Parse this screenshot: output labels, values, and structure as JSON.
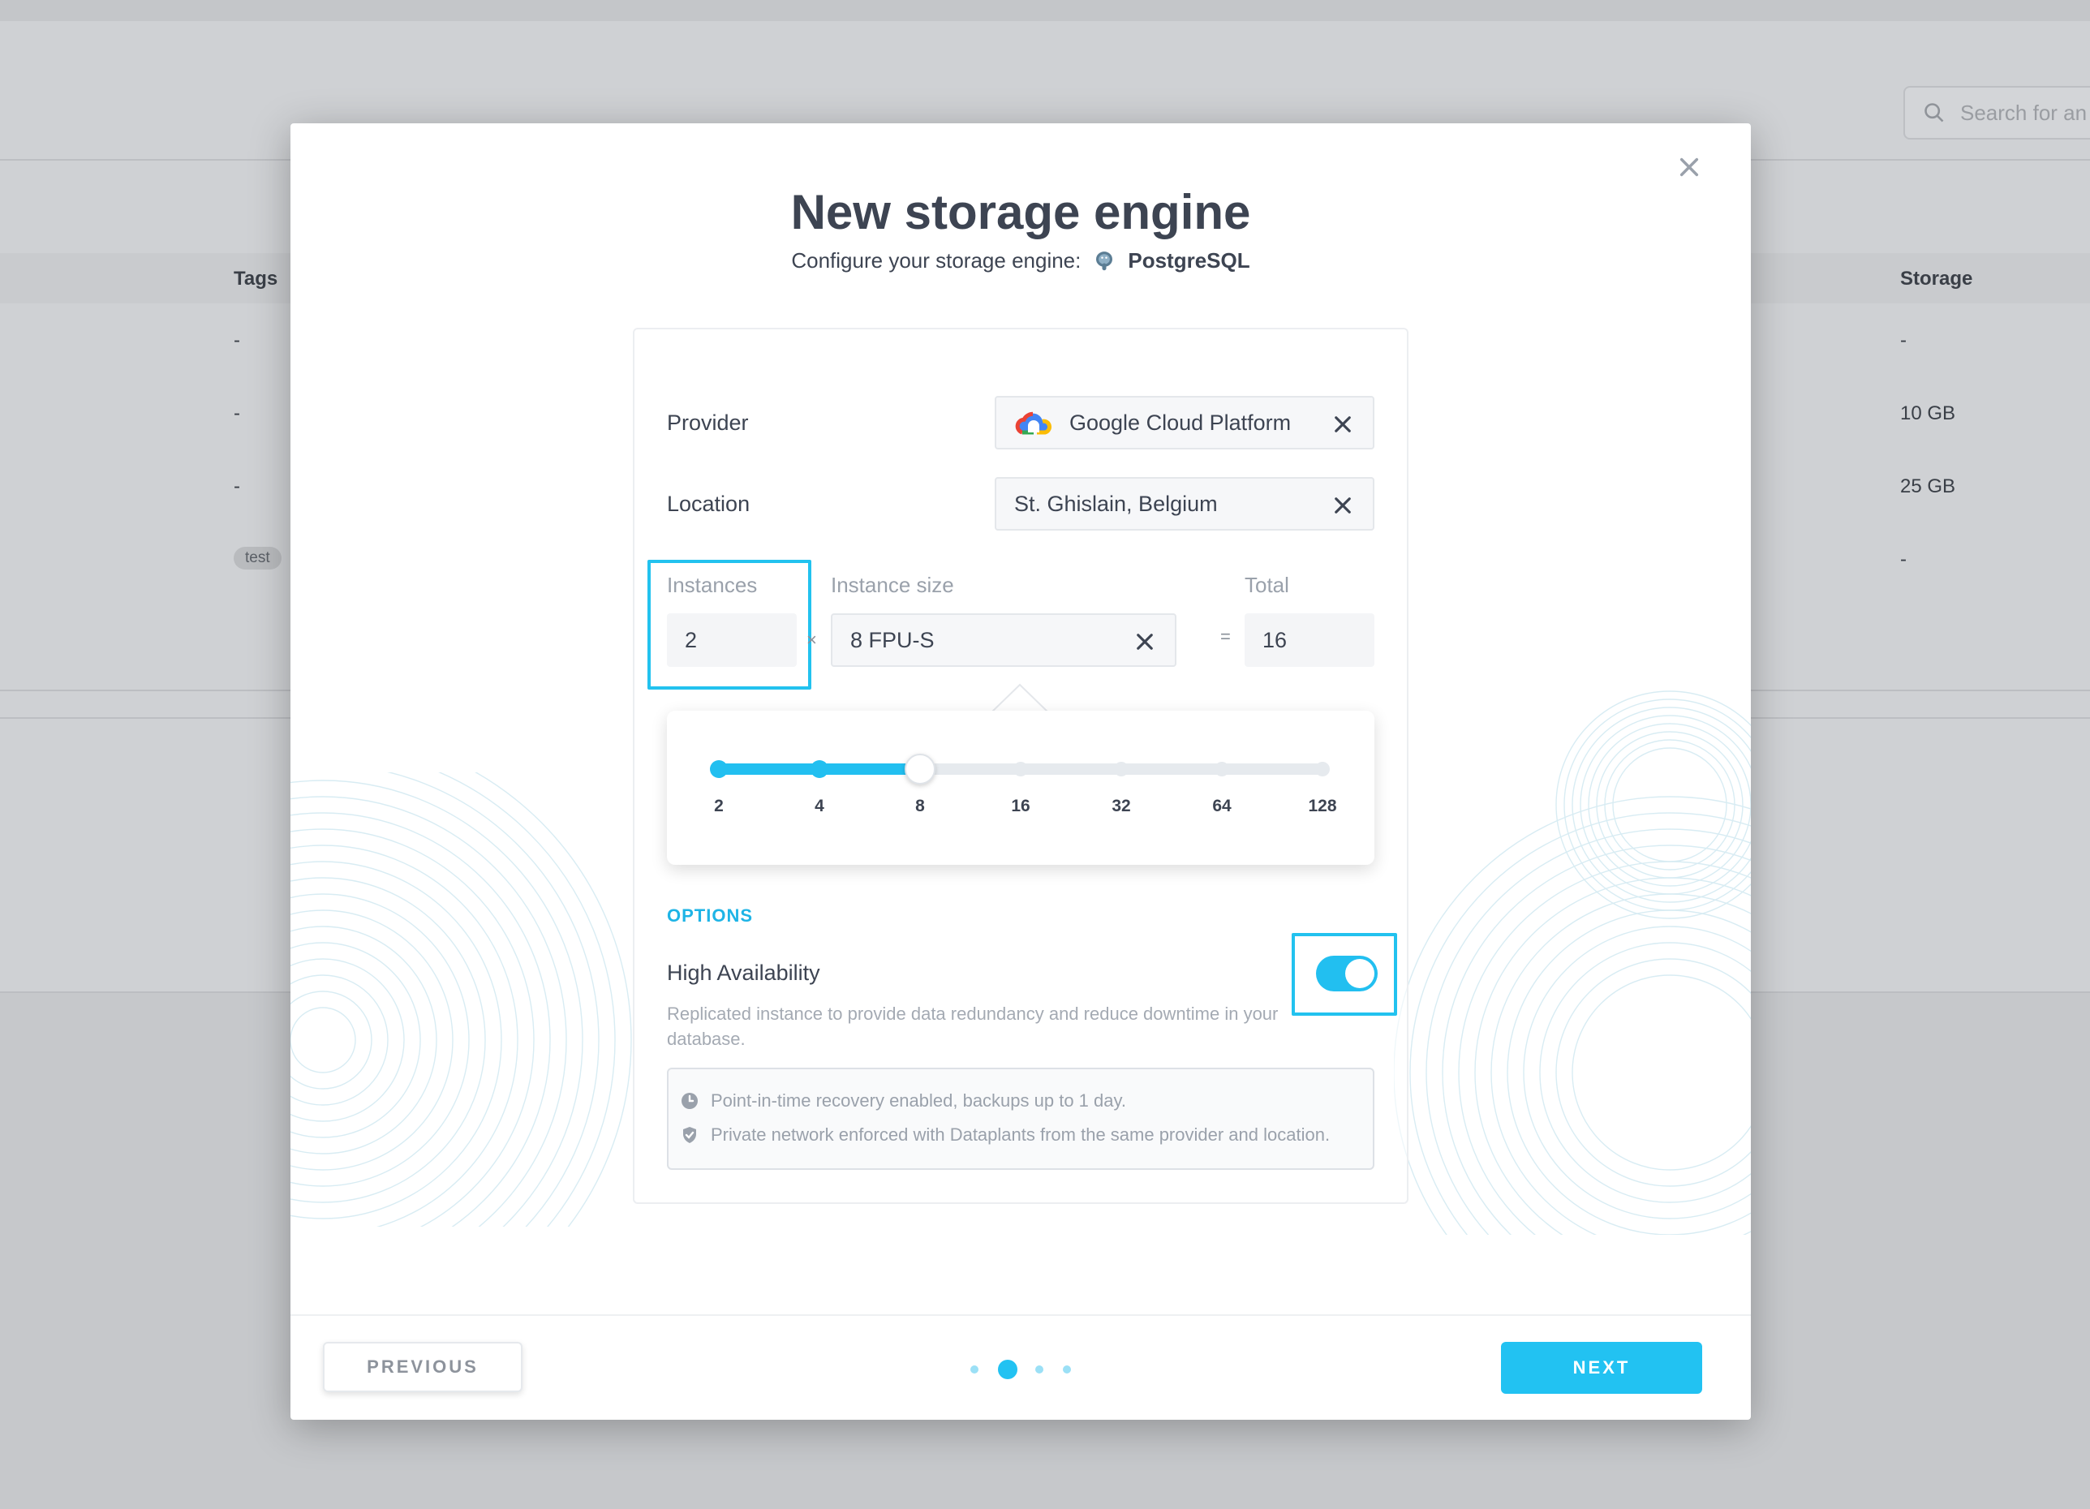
{
  "background": {
    "search_placeholder": "Search for an",
    "columns": {
      "tags": "Tags",
      "storage": "Storage"
    },
    "rows": [
      {
        "tags": "-",
        "storage": "-"
      },
      {
        "tags": "-",
        "storage": "10 GB"
      },
      {
        "tags": "-",
        "storage": "25 GB"
      },
      {
        "tag_badge": "test",
        "storage": "-"
      }
    ]
  },
  "modal": {
    "title": "New storage engine",
    "subtitle": "Configure your storage engine:",
    "engine_icon": "postgresql-elephant-icon",
    "engine_name": "PostgreSQL",
    "provider": {
      "label": "Provider",
      "value": "Google Cloud Platform",
      "icon": "google-cloud-logo"
    },
    "location": {
      "label": "Location",
      "value": "St. Ghislain, Belgium"
    },
    "instances": {
      "label": "Instances",
      "value": "2"
    },
    "instance_size": {
      "label": "Instance size",
      "value": "8 FPU-S"
    },
    "total": {
      "label": "Total",
      "value": "16"
    },
    "multiply_sign": "×",
    "equals_sign": "=",
    "size_slider": {
      "ticks": [
        "2",
        "4",
        "8",
        "16",
        "32",
        "64",
        "128"
      ],
      "selected_index": 2,
      "active_color": "#22bff0",
      "inactive_color": "#e6eaee"
    },
    "options_heading": "OPTIONS",
    "high_availability": {
      "label": "High Availability",
      "description": "Replicated instance to provide data redundancy and reduce downtime in your database.",
      "enabled": true
    },
    "info": [
      {
        "icon": "clock-icon",
        "text": "Point-in-time recovery enabled, backups up to 1 day."
      },
      {
        "icon": "shield-check-icon",
        "text": "Private network enforced with Dataplants from the same provider and location."
      }
    ],
    "footer": {
      "previous_label": "PREVIOUS",
      "next_label": "NEXT",
      "steps_total": 4,
      "current_step": 2
    }
  },
  "colors": {
    "accent": "#22c2f2",
    "highlight": "#22c2ef",
    "text": "#3d4452",
    "muted": "#9aa1ab"
  }
}
